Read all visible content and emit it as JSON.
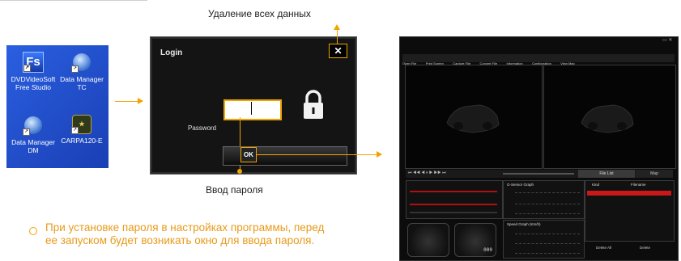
{
  "captions": {
    "delete_all": "Удаление всех данных",
    "password_entry": "Ввод пароля"
  },
  "note": {
    "text": "При установке пароля в настройках программы, перед ее запуском будет возникать окно для ввода пароля."
  },
  "desktop": {
    "icons": [
      {
        "label": "DVDVideoSoft Free Studio",
        "icon": "free-studio-icon"
      },
      {
        "label": "Data Manager TC",
        "icon": "data-manager-icon"
      },
      {
        "label": "Data Manager DM",
        "icon": "data-manager-icon"
      },
      {
        "label": "CARPA120-E",
        "icon": "carpa-icon"
      }
    ]
  },
  "login": {
    "title": "Login",
    "close_label": "✕",
    "password_label": "Password",
    "password_value": "",
    "ok_label": "OK"
  },
  "app": {
    "menu": [
      "Open File",
      "Print Screen",
      "Capture File",
      "Convert File",
      "Information",
      "Configuration",
      "View Map"
    ],
    "tabs": {
      "file_list": "File List",
      "map": "Map"
    },
    "file_list": {
      "col_kind": "Kind",
      "col_filename": "Filename"
    },
    "gsensor_title": "G-Sensor Graph",
    "speed_title": "Speed Graph (Km/h)",
    "buttons": {
      "delete_all": "Delete All",
      "delete": "Delete"
    },
    "speed_readout": "000"
  },
  "colors": {
    "accent": "#f0a400",
    "note": "#e89a1a",
    "desktop_blue": "#1f4fc7"
  }
}
